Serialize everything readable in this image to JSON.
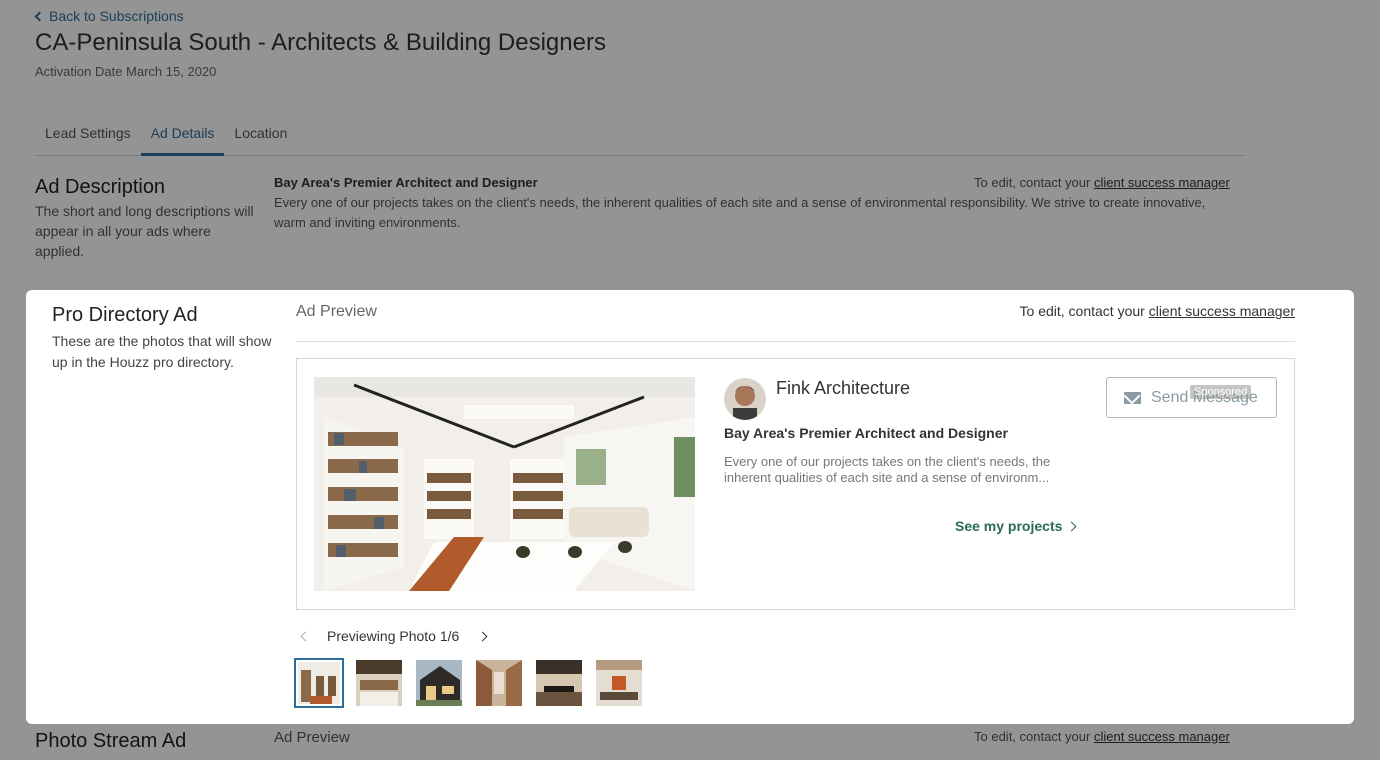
{
  "header": {
    "back_label": "Back to Subscriptions",
    "title": "CA-Peninsula South - Architects & Building Designers",
    "activation": "Activation Date March 15, 2020"
  },
  "tabs": [
    {
      "label": "Lead Settings",
      "active": false
    },
    {
      "label": "Ad Details",
      "active": true
    },
    {
      "label": "Location",
      "active": false
    }
  ],
  "ad_description": {
    "title": "Ad Description",
    "desc": "The short and long descriptions will appear in all your ads where applied.",
    "headline": "Bay Area's Premier Architect and Designer",
    "body": "Every one of our projects takes on the client's needs, the inherent qualities of each site and a sense of environmental responsibility. We strive to create innovative, warm and inviting environments.",
    "edit_prefix": "To edit, contact your ",
    "edit_link": "client success manager"
  },
  "pro_directory": {
    "title": "Pro Directory Ad",
    "desc": "These are the photos that will show up in the Houzz pro directory.",
    "preview_label": "Ad Preview",
    "edit_prefix": "To edit, contact your ",
    "edit_link": "client success manager",
    "card": {
      "pro_name": "Fink Architecture",
      "headline": "Bay Area's Premier Architect and Designer",
      "body": "Every one of our projects takes on the client's needs, the inherent qualities of each site and a sense of environm...",
      "see_projects": "See my projects",
      "send_message": "Send Message",
      "sponsored": "Sponsored"
    },
    "pager_label": "Previewing Photo 1/6",
    "thumb_count": 6,
    "selected_thumb": 1
  },
  "photo_stream": {
    "title": "Photo Stream Ad",
    "preview_label": "Ad Preview",
    "edit_prefix": "To edit, contact your ",
    "edit_link": "client success manager"
  },
  "colors": {
    "link_blue": "#2c6e9b",
    "green": "#2b6a5b"
  }
}
